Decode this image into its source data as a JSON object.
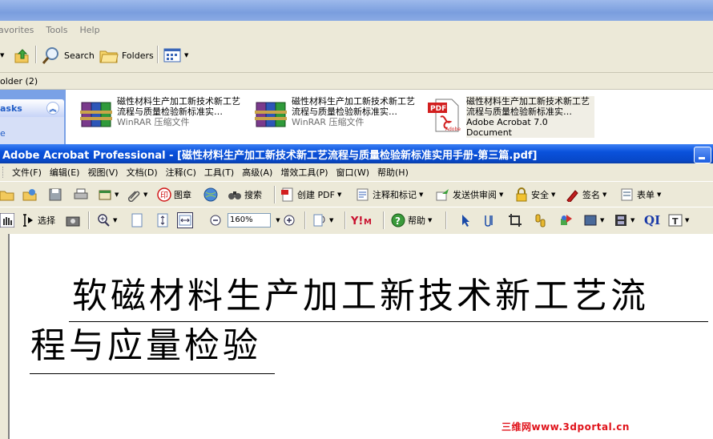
{
  "explorer": {
    "menu": [
      "avorites",
      "Tools",
      "Help"
    ],
    "toolbar": {
      "search_label": "Search",
      "folders_label": "Folders"
    },
    "address_text": "older (2)",
    "tasks_label": "asks",
    "tasks_item": "e",
    "files": [
      {
        "name": "磁性材料生产加工新技术新工艺流程与质量检验新标准实…",
        "type": "WinRAR 压缩文件",
        "icon": "winrar-icon"
      },
      {
        "name": "磁性材料生产加工新技术新工艺流程与质量检验新标准实…",
        "type": "WinRAR 压缩文件",
        "icon": "winrar-icon"
      },
      {
        "name": "磁性材料生产加工新技术新工艺流程与质量检验新标准实…",
        "type": "Adobe Acrobat 7.0 Document",
        "icon": "pdf-icon"
      }
    ],
    "pdf_icon_text": "PDF"
  },
  "acrobat": {
    "title": "Adobe Acrobat Professional - [磁性材料生产加工新技术新工艺流程与质量检验新标准实用手册-第三篇.pdf]",
    "menu": [
      "文件(F)",
      "编辑(E)",
      "视图(V)",
      "文档(D)",
      "注释(C)",
      "工具(T)",
      "高级(A)",
      "增效工具(P)",
      "窗口(W)",
      "帮助(H)"
    ],
    "toolbar1": {
      "stamp_label": "图章",
      "search_label": "搜索",
      "create_pdf_label": "创建 PDF",
      "comment_label": "注释和标记",
      "send_review_label": "发送供审阅",
      "security_label": "安全",
      "sign_label": "签名",
      "forms_label": "表单"
    },
    "toolbar2": {
      "select_label": "选择",
      "zoom_value": "160%",
      "help_label": "帮助",
      "qi_label": "QI"
    }
  },
  "document": {
    "line1": "软磁材料生产加工新技术新工艺流",
    "line2": "程与应量检验"
  },
  "watermark": "三维网www.3dportal.cn"
}
